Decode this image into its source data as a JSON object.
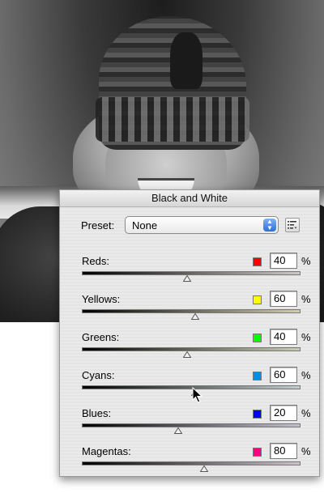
{
  "panel": {
    "title": "Black and White",
    "preset_label": "Preset:",
    "preset_value": "None",
    "preset_menu_icon": "list-options-icon"
  },
  "channels": [
    {
      "label": "Reds:",
      "value": "40",
      "unit": "%",
      "swatch": "#ff0000",
      "fraction": 0.48,
      "track": [
        "#000000",
        "#cfc9c6"
      ]
    },
    {
      "label": "Yellows:",
      "value": "60",
      "unit": "%",
      "swatch": "#ffff00",
      "fraction": 0.52,
      "track": [
        "#000000",
        "#d2cfb2"
      ]
    },
    {
      "label": "Greens:",
      "value": "40",
      "unit": "%",
      "swatch": "#00ff00",
      "fraction": 0.48,
      "track": [
        "#000000",
        "#c8cfb2"
      ]
    },
    {
      "label": "Cyans:",
      "value": "60",
      "unit": "%",
      "swatch": "#0090e0",
      "fraction": 0.52,
      "track": [
        "#000000",
        "#c2cfcf"
      ]
    },
    {
      "label": "Blues:",
      "value": "20",
      "unit": "%",
      "swatch": "#0000ff",
      "fraction": 0.44,
      "track": [
        "#000000",
        "#c2c2cf"
      ]
    },
    {
      "label": "Magentas:",
      "value": "80",
      "unit": "%",
      "swatch": "#ff0080",
      "fraction": 0.56,
      "track": [
        "#000000",
        "#cfc2cb"
      ]
    }
  ],
  "colors": {
    "select_arrow": "#2c6fd6",
    "panel_bg": "#e7e7e7"
  }
}
